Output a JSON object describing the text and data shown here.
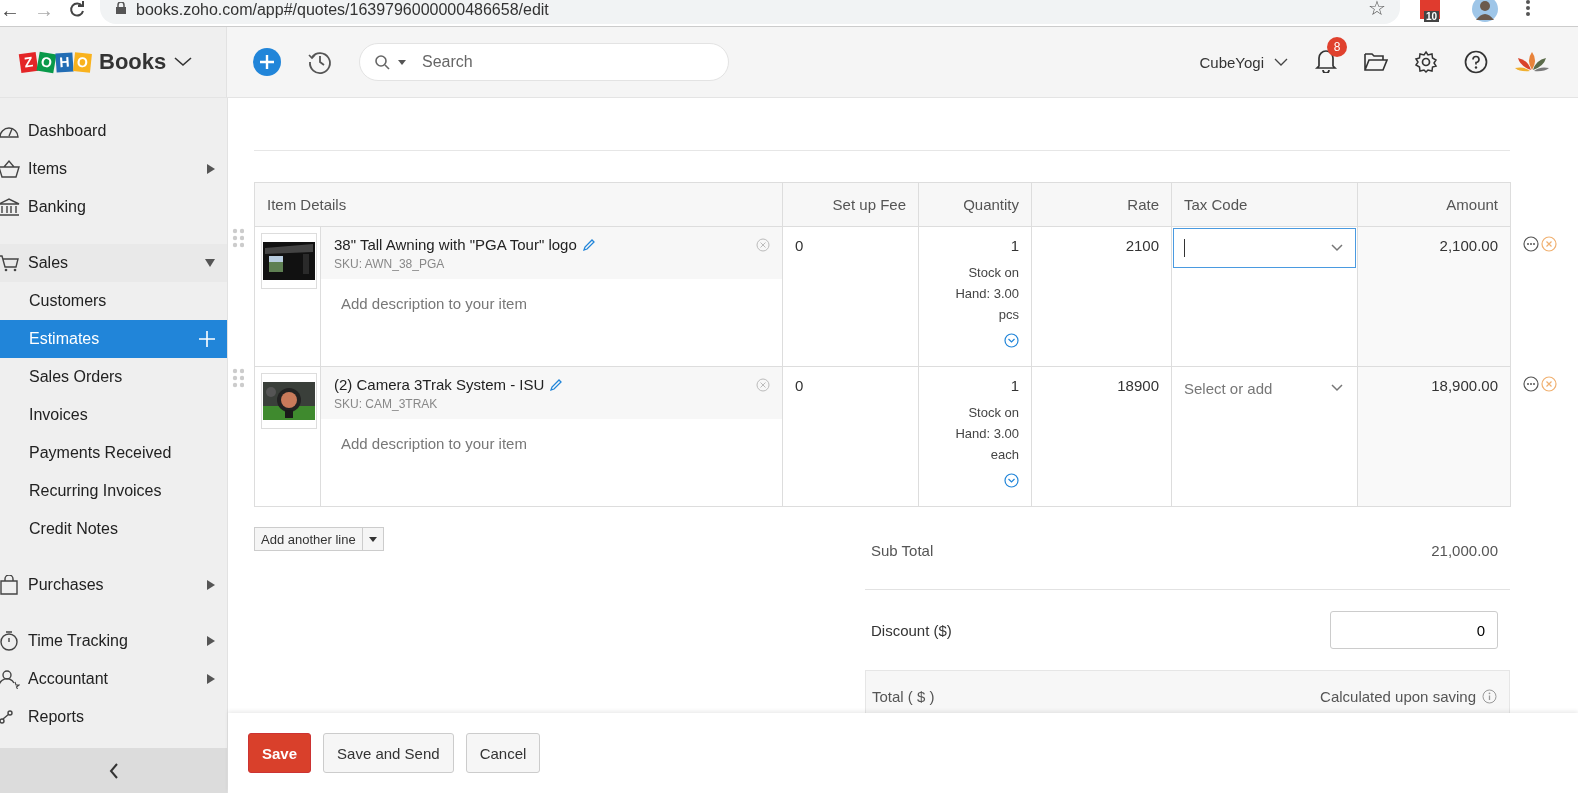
{
  "browser": {
    "back": "←",
    "forward": "→",
    "star": "☆",
    "url": "books.zoho.com/app#/quotes/1639796000000486658/edit",
    "extension_badge": "10"
  },
  "header": {
    "logo_letters": [
      "Z",
      "O",
      "H",
      "O"
    ],
    "product": "Books",
    "search": {
      "placeholder": "Search"
    },
    "organization": "CubeYogi",
    "notifications": "8"
  },
  "sidebar": {
    "groups": [
      [
        {
          "label": "Dashboard"
        },
        {
          "label": "Items",
          "expanded": false
        },
        {
          "label": "Banking"
        }
      ],
      [
        {
          "label": "Sales",
          "expanded": true,
          "children": [
            {
              "label": "Customers",
              "selected": false
            },
            {
              "label": "Estimates",
              "selected": true
            },
            {
              "label": "Sales Orders",
              "selected": false
            },
            {
              "label": "Invoices",
              "selected": false
            },
            {
              "label": "Payments Received",
              "selected": false
            },
            {
              "label": "Recurring Invoices",
              "selected": false
            },
            {
              "label": "Credit Notes",
              "selected": false
            }
          ]
        }
      ],
      [
        {
          "label": "Purchases",
          "expanded": false
        }
      ],
      [
        {
          "label": "Time Tracking",
          "expanded": false
        },
        {
          "label": "Accountant",
          "expanded": false
        },
        {
          "label": "Reports"
        }
      ]
    ]
  },
  "table": {
    "columns": [
      "Item Details",
      "Set up Fee",
      "Quantity",
      "Rate",
      "Tax Code",
      "Amount"
    ],
    "rows": [
      {
        "name": "38\" Tall Awning with \"PGA Tour\" logo",
        "sku": "SKU: AWN_38_PGA",
        "description_placeholder": "Add description to your item",
        "setup_fee": "0",
        "quantity": "1",
        "stock": "Stock on Hand: 3.00 pcs",
        "rate": "2100",
        "tax_code": {
          "focused": true
        },
        "amount": "2,100.00"
      },
      {
        "name": "(2) Camera 3Trak System - ISU",
        "sku": "SKU: CAM_3TRAK",
        "description_placeholder": "Add description to your item",
        "setup_fee": "0",
        "quantity": "1",
        "stock": "Stock on Hand: 3.00 each",
        "rate": "18900",
        "tax_code": {
          "focused": false,
          "placeholder": "Select or add"
        },
        "amount": "18,900.00"
      }
    ]
  },
  "add_line": "Add another line",
  "totals": {
    "sub_total_label": "Sub Total",
    "sub_total": "21,000.00",
    "discount_label": "Discount ($)",
    "discount": "0",
    "total_label": "Total ( $ )",
    "total_note": "Calculated upon saving"
  },
  "footer": {
    "buttons": [
      {
        "label": "Save",
        "kind": "primary"
      },
      {
        "label": "Save and Send",
        "kind": "secondary"
      },
      {
        "label": "Cancel",
        "kind": "secondary"
      }
    ]
  }
}
